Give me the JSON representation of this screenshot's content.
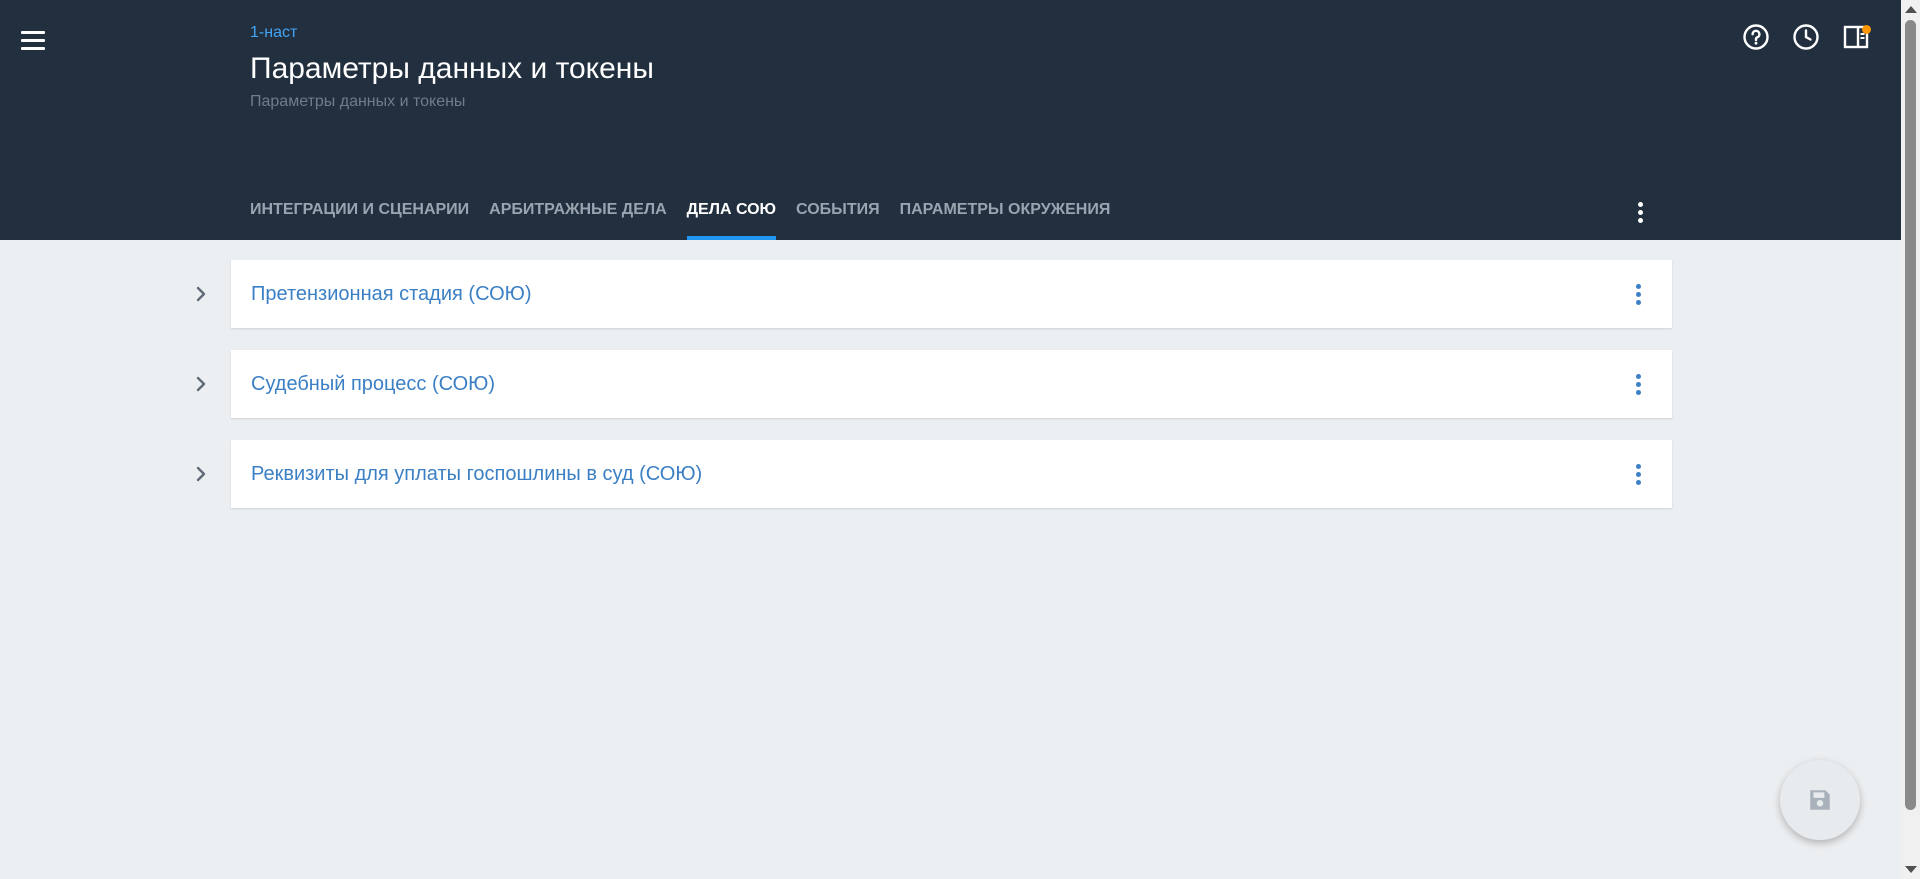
{
  "header": {
    "breadcrumb": "1-наст",
    "title": "Параметры данных и токены",
    "subtitle": "Параметры данных и токены",
    "icons": [
      "menu-icon",
      "help-icon",
      "history-icon",
      "panel-icon"
    ]
  },
  "tabs": [
    {
      "label": "ИНТЕГРАЦИИ И СЦЕНАРИИ",
      "active": false
    },
    {
      "label": "АРБИТРАЖНЫЕ ДЕЛА",
      "active": false
    },
    {
      "label": "ДЕЛА СОЮ",
      "active": true
    },
    {
      "label": "СОБЫТИЯ",
      "active": false
    },
    {
      "label": "ПАРАМЕТРЫ ОКРУЖЕНИЯ",
      "active": false
    }
  ],
  "sections": [
    {
      "title": "Претензионная стадия (СОЮ)"
    },
    {
      "title": "Судебный процесс (СОЮ)"
    },
    {
      "title": "Реквизиты для уплаты госпошлины в суд (СОЮ)"
    }
  ],
  "colors": {
    "header_bg": "#222f3e",
    "accent": "#2196f3",
    "link": "#3b7fc4",
    "notification": "#ff9800",
    "page_bg": "#eceff1"
  },
  "fab": {
    "icon": "save-icon"
  }
}
